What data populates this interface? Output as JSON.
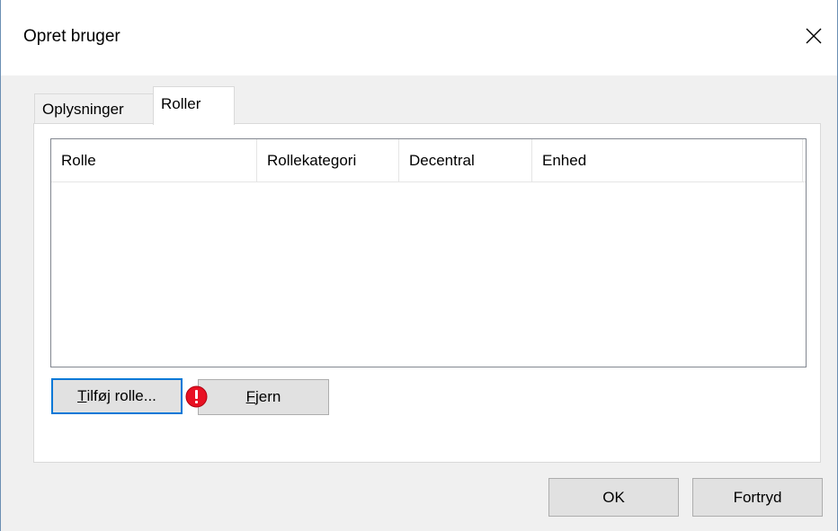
{
  "window": {
    "title": "Opret bruger",
    "close_icon": "close-icon"
  },
  "tabs": [
    {
      "label": "Oplysninger",
      "active": false
    },
    {
      "label": "Roller",
      "active": true
    }
  ],
  "roles_table": {
    "columns": [
      "Rolle",
      "Rollekategori",
      "Decentral",
      "Enhed"
    ],
    "rows": []
  },
  "buttons": {
    "add_role_mnemonic": "T",
    "add_role_rest": "ilføj rolle...",
    "remove_mnemonic": "F",
    "remove_rest": "jern",
    "ok": "OK",
    "cancel": "Fortryd"
  },
  "icons": {
    "warning": "error-icon",
    "warning_color": "#e81123"
  },
  "colors": {
    "accent": "#0078d7"
  }
}
